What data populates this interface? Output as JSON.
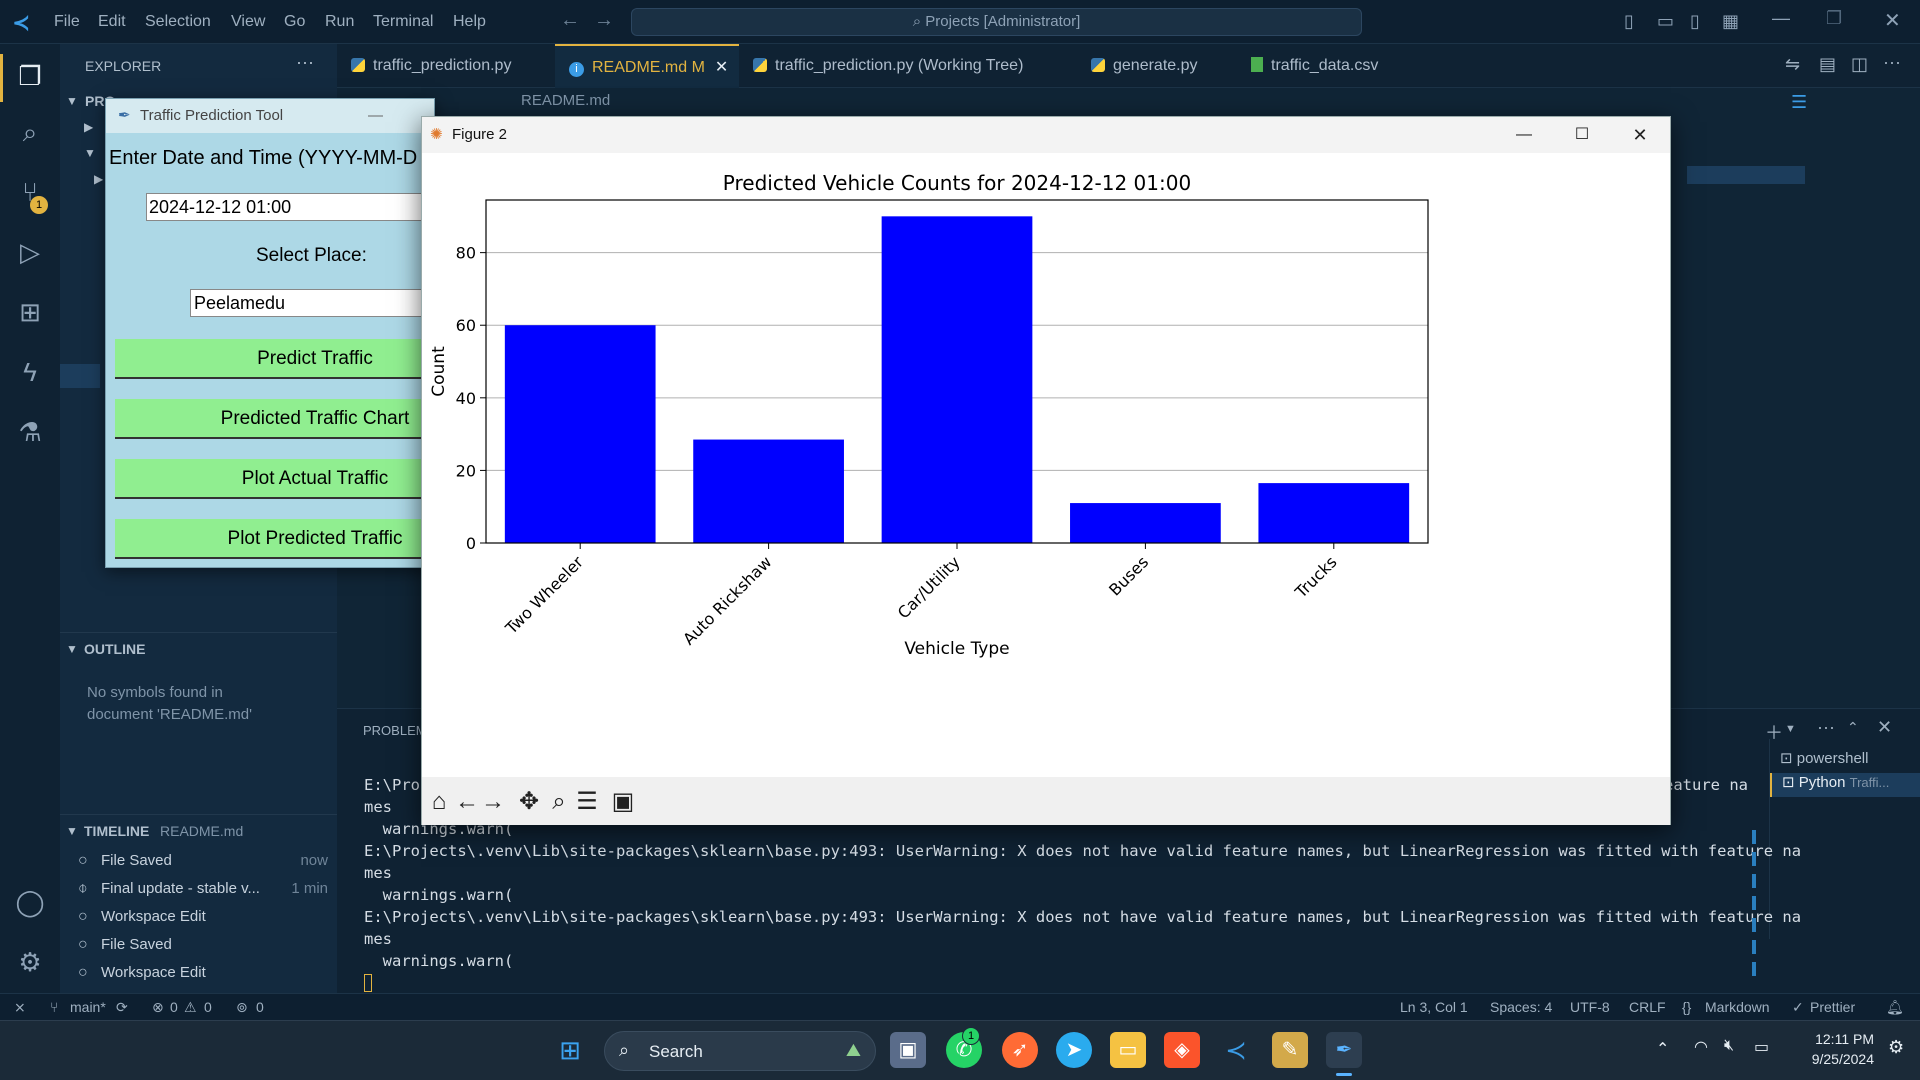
{
  "vscode": {
    "menu": [
      "File",
      "Edit",
      "Selection",
      "View",
      "Go",
      "Run",
      "Terminal",
      "Help"
    ],
    "search": "Projects [Administrator]",
    "explorer_title": "EXPLORER",
    "explorer_root_short": "PRO",
    "source_control_badge": "1",
    "tabs": [
      {
        "label": "traffic_prediction.py",
        "icon": "python-icon",
        "active": false
      },
      {
        "label": "README.md",
        "modified": "M",
        "icon": "info-icon",
        "active": true
      },
      {
        "label": "traffic_prediction.py (Working Tree)",
        "icon": "python-icon",
        "active": false
      },
      {
        "label": "generate.py",
        "icon": "python-icon",
        "active": false
      },
      {
        "label": "traffic_data.csv",
        "icon": "csv-icon",
        "active": false
      }
    ],
    "breadcrumb": "README.md",
    "outline": {
      "header": "OUTLINE",
      "empty_text": "No symbols found in document 'README.md'"
    },
    "timeline": {
      "header": "TIMELINE",
      "file": "README.md",
      "items": [
        {
          "label": "File Saved",
          "time": "now"
        },
        {
          "label": "Final update - stable v...",
          "time": "1 min"
        },
        {
          "label": "Workspace Edit",
          "time": ""
        },
        {
          "label": "File Saved",
          "time": ""
        },
        {
          "label": "Workspace Edit",
          "time": ""
        }
      ]
    },
    "panel": {
      "tab": "PROBLEM",
      "terminals": [
        {
          "label": "powershell"
        },
        {
          "label": "Python",
          "detail": "Traffi..."
        }
      ],
      "lines": [
        "E:\\Pro",
        "mes",
        "  warnings.warn(",
        "E:\\Projects\\.venv\\Lib\\site-packages\\sklearn\\base.py:493: UserWarning: X does not have valid feature names, but LinearRegression was fitted with feature na",
        "mes",
        "  warnings.warn(",
        "E:\\Projects\\.venv\\Lib\\site-packages\\sklearn\\base.py:493: UserWarning: X does not have valid feature names, but LinearRegression was fitted with feature na",
        "mes",
        "  warnings.warn("
      ],
      "line1_tail": "eature na"
    },
    "status": {
      "branch": "main*",
      "errors": "0",
      "warnings": "0",
      "ports": "0",
      "position": "Ln 3, Col 1",
      "spaces": "Spaces: 4",
      "encoding": "UTF-8",
      "eol": "CRLF",
      "language": "Markdown",
      "formatter": "Prettier"
    }
  },
  "tk_window": {
    "title": "Traffic Prediction Tool",
    "prompt": "Enter Date and Time (YYYY-MM-D",
    "datetime_value": "2024-12-12 01:00",
    "place_label": "Select Place:",
    "place_value": "Peelamedu",
    "buttons": [
      "Predict Traffic",
      "Predicted Traffic Chart",
      "Plot Actual Traffic",
      "Plot Predicted Traffic"
    ]
  },
  "figure_window": {
    "title": "Figure 2"
  },
  "chart_data": {
    "type": "bar",
    "title": "Predicted Vehicle Counts for 2024-12-12 01:00",
    "xlabel": "Vehicle Type",
    "ylabel": "Count",
    "categories": [
      "Two Wheeler",
      "Auto Rickshaw",
      "Car/Utility",
      "Buses",
      "Trucks"
    ],
    "values": [
      60,
      28.5,
      90,
      11,
      16.5
    ],
    "ylim": [
      0,
      94.5
    ],
    "yticks": [
      0,
      20,
      40,
      60,
      80
    ],
    "grid": "y",
    "bar_color": "#0000ff"
  },
  "taskbar": {
    "search": "Search",
    "time": "12:11 PM",
    "date": "9/25/2024",
    "whatsapp_badge": "1"
  }
}
